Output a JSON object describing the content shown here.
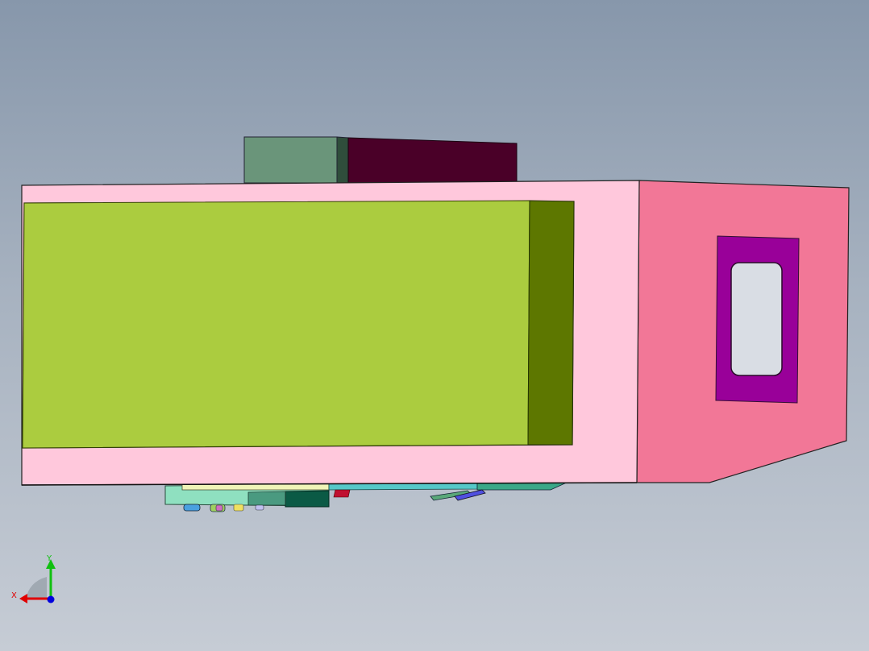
{
  "viewport": {
    "background_top": "#8797ab",
    "background_bottom": "#c6ccd5"
  },
  "model": {
    "parts": [
      {
        "name": "enclosure-front-frame",
        "color": "#ffc8dc"
      },
      {
        "name": "enclosure-side-face",
        "color": "#f27797"
      },
      {
        "name": "battery-pack-face",
        "color": "#abcc3f"
      },
      {
        "name": "battery-pack-side",
        "color": "#5d7700"
      },
      {
        "name": "top-module-green",
        "color": "#6a957a"
      },
      {
        "name": "top-module-dark-red",
        "color": "#4a0028"
      },
      {
        "name": "side-window-frame",
        "color": "#990099"
      },
      {
        "name": "pcb-board",
        "color": "#7dd6b8"
      },
      {
        "name": "connector-block",
        "color": "#0b5a45"
      }
    ]
  },
  "triad": {
    "x_label": "X",
    "y_label": "Y",
    "x_color": "#e00000",
    "y_color": "#10c010",
    "z_color": "#0000dd"
  }
}
